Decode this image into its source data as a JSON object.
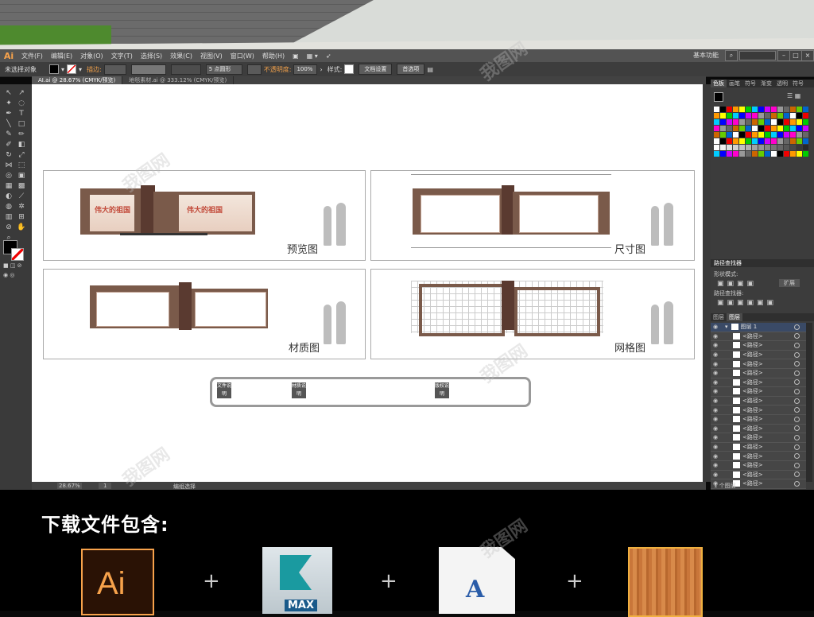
{
  "app": {
    "logo": "Ai"
  },
  "menu": [
    "文件(F)",
    "编辑(E)",
    "对象(O)",
    "文字(T)",
    "选择(S)",
    "效果(C)",
    "视图(V)",
    "窗口(W)",
    "帮助(H)"
  ],
  "workspace": "基本功能",
  "control": {
    "selection": "未选择对象",
    "stroke_label": "描边:",
    "stroke_value": "5 点圆形",
    "opacity_label": "不透明度:",
    "opacity_value": "100%",
    "style_label": "样式:",
    "doc_setup": "文档设置",
    "preferences": "首选项"
  },
  "tabs": [
    "AI.ai @ 28.67% (CMYK/预览)",
    "地毯素材.ai @ 333.12% (CMYK/预览)"
  ],
  "status": {
    "zoom": "28.67%",
    "page": "1",
    "status_text": "编组选择"
  },
  "panels": {
    "swatch_tabs": [
      "色板",
      "画笔",
      "符号",
      "渐变",
      "透明",
      "符号"
    ],
    "pathfinder_title": "路径查找器",
    "shape_modes": "形状模式:",
    "expand": "扩展",
    "pathfinders": "路径查找器:",
    "layer_tabs": [
      "图层",
      "图层"
    ],
    "layer_group": "图层 1",
    "layer_item": "<路径>",
    "layer_count": "1 个图层"
  },
  "artboards": {
    "preview": "预览图",
    "dimensions": "尺寸图",
    "materials": "材质图",
    "grid": "网格图",
    "banner_text": "伟大的祖国",
    "notes": [
      "文件说明",
      "材质说明",
      "版权说明"
    ]
  },
  "bottom": {
    "title": "下载文件包含:",
    "plus": "+",
    "icons": {
      "ai_label": "Ai",
      "max_label": "MAX",
      "font_label": "A"
    }
  },
  "colors": {
    "accent": "#f7a24b",
    "board_brown": "#7a5a4a",
    "banner_red": "#c24a3a"
  }
}
